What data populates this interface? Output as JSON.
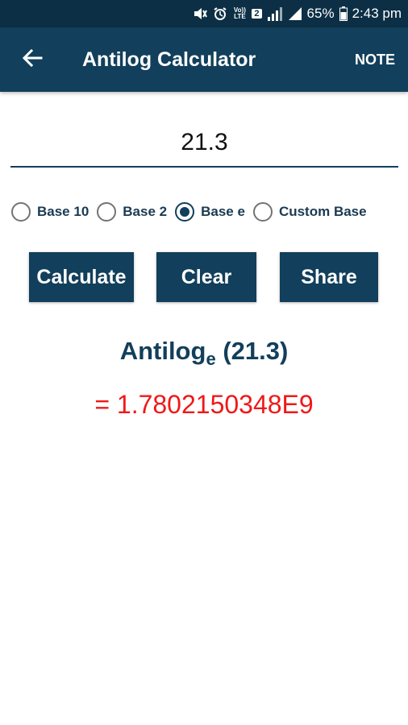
{
  "status_bar": {
    "battery": "65%",
    "time": "2:43 pm",
    "volte": "Vo)) LTE",
    "sim": "2"
  },
  "app_bar": {
    "title": "Antilog Calculator",
    "note": "NOTE"
  },
  "input": {
    "value": "21.3"
  },
  "radios": [
    {
      "label": "Base 10",
      "checked": false
    },
    {
      "label": "Base 2",
      "checked": false
    },
    {
      "label": "Base e",
      "checked": true
    },
    {
      "label": "Custom Base",
      "checked": false
    }
  ],
  "buttons": {
    "calculate": "Calculate",
    "clear": "Clear",
    "share": "Share"
  },
  "result": {
    "func": "Antilog",
    "base": "e",
    "argument": "(21.3)",
    "value": "= 1.7802150348E9"
  },
  "colors": {
    "primary": "#123f5b",
    "status_bar": "#0c2f45",
    "result": "#f01818"
  }
}
